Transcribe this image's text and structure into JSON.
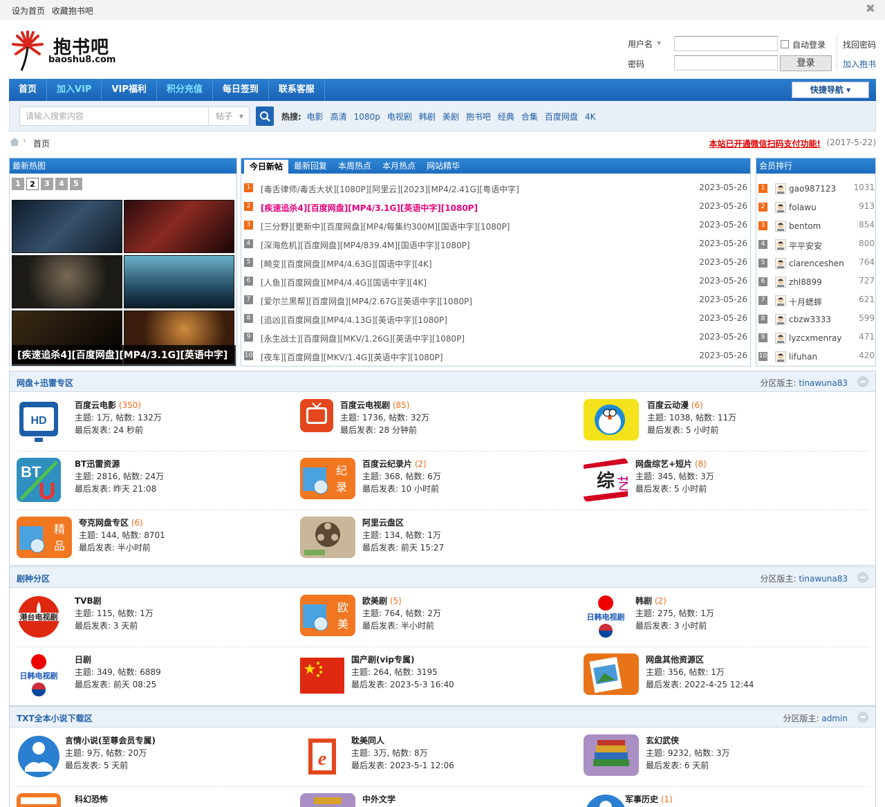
{
  "topbar": {
    "set_home": "设为首页",
    "bookmark": "收藏抱书吧"
  },
  "logo": {
    "cn": "抱书吧",
    "en": "baoshu8.com"
  },
  "login": {
    "username_label": "用户名",
    "password_label": "密码",
    "auto_login": "自动登录",
    "login_btn": "登录",
    "forgot": "找回密码",
    "register": "加入抱书"
  },
  "nav": {
    "items": [
      "首页",
      "加入VIP",
      "VIP福利",
      "积分充值",
      "每日签到",
      "联系客服"
    ],
    "quick_nav": "快捷导航"
  },
  "search": {
    "placeholder": "请输入搜索内容",
    "type": "帖子",
    "hot_label": "热搜:",
    "hot": [
      "电影",
      "高清",
      "1080p",
      "电视剧",
      "韩剧",
      "美剧",
      "抱书吧",
      "经典",
      "合集",
      "百度网盘",
      "4K"
    ]
  },
  "breadcrumb": {
    "home": "首页",
    "notice": "本站已开通微信扫码支付功能!",
    "date": "(2017-5-22)"
  },
  "hotpic": {
    "title": "最新热图",
    "nums": [
      "1",
      "2",
      "3",
      "4",
      "5"
    ],
    "caption": "[疾速追杀4][百度网盘][MP4/3.1G][英语中字]"
  },
  "newest": {
    "tabs": [
      "今日新帖",
      "最新回复",
      "本周热点",
      "本月热点",
      "网站精华"
    ],
    "rows": [
      {
        "n": "1",
        "title": "[毒舌律师/毒舌大状][1080P][阿里云][2023][MP4/2.41G][粤语中字]",
        "date": "2023-05-26"
      },
      {
        "n": "2",
        "title": "[疾速追杀4][百度网盘][MP4/3.1G][英语中字][1080P]",
        "date": "2023-05-26"
      },
      {
        "n": "3",
        "title": "[三分野][更新中][百度网盘][MP4/每集约300M][国语中字][1080P]",
        "date": "2023-05-26"
      },
      {
        "n": "4",
        "title": "[深海危机][百度网盘][MP4/839.4M][国语中字][1080P]",
        "date": "2023-05-26"
      },
      {
        "n": "5",
        "title": "[畸变][百度网盘][MP4/4.63G][国语中字][4K]",
        "date": "2023-05-26"
      },
      {
        "n": "6",
        "title": "[人鱼][百度网盘][MP4/4.4G][国语中字][4K]",
        "date": "2023-05-26"
      },
      {
        "n": "7",
        "title": "[爱尔兰黑帮][百度网盘][MP4/2.67G][英语中字][1080P]",
        "date": "2023-05-26"
      },
      {
        "n": "8",
        "title": "[追凶][百度网盘][MP4/4.13G][英语中字][1080P]",
        "date": "2023-05-26"
      },
      {
        "n": "9",
        "title": "[永生战士][百度网盘][MKV/1.26G][英语中字][1080P]",
        "date": "2023-05-26"
      },
      {
        "n": "10",
        "title": "[夜车][百度网盘][MKV/1.4G][英语中字][1080P]",
        "date": "2023-05-26"
      }
    ]
  },
  "ranking": {
    "title": "会员排行",
    "rows": [
      {
        "n": "1",
        "name": "gao987123",
        "score": "1031"
      },
      {
        "n": "2",
        "name": "folawu",
        "score": "913"
      },
      {
        "n": "3",
        "name": "bentom",
        "score": "854"
      },
      {
        "n": "4",
        "name": "平平安安",
        "score": "800"
      },
      {
        "n": "5",
        "name": "clarenceshen",
        "score": "764"
      },
      {
        "n": "6",
        "name": "zhl8899",
        "score": "727"
      },
      {
        "n": "7",
        "name": "十月蟋蟀",
        "score": "621"
      },
      {
        "n": "8",
        "name": "cbzw3333",
        "score": "599"
      },
      {
        "n": "9",
        "name": "lyzcxmenray",
        "score": "471"
      },
      {
        "n": "10",
        "name": "lifuhan",
        "score": "420"
      }
    ]
  },
  "sections": [
    {
      "title": "网盘+迅雷专区",
      "mod_label": "分区版主:",
      "mod": "tinawuna83",
      "forums": [
        {
          "name": "百度云电影",
          "count": "(350)",
          "stats": "主题: 1万, 帖数: 132万",
          "last": "最后发表: 24 秒前",
          "icon": "hd-tv-icon"
        },
        {
          "name": "百度云电视剧",
          "count": "(85)",
          "stats": "主题: 1736, 帖数: 32万",
          "last": "最后发表: 28 分钟前",
          "icon": "tv-icon"
        },
        {
          "name": "百度云动漫",
          "count": "(6)",
          "stats": "主题: 1038, 帖数: 11万",
          "last": "最后发表: 5 小时前",
          "icon": "doraemon-icon"
        },
        {
          "name": "BT迅雷资源",
          "count": "",
          "stats": "主题: 2816, 帖数: 24万",
          "last": "最后发表: 昨天 21:08",
          "icon": "bt-magnet-icon"
        },
        {
          "name": "百度云纪录片",
          "count": "(2)",
          "stats": "主题: 368, 帖数: 6万",
          "last": "最后发表: 10 小时前",
          "icon": "documentary-box-icon"
        },
        {
          "name": "网盘综艺+短片",
          "count": "(8)",
          "stats": "主题: 345, 帖数: 3万",
          "last": "最后发表: 5 小时前",
          "icon": "variety-show-icon"
        },
        {
          "name": "夸克网盘专区",
          "count": "(6)",
          "stats": "主题: 144, 帖数: 8701",
          "last": "最后发表: 半小时前",
          "icon": "premium-box-icon"
        },
        {
          "name": "阿里云盘区",
          "count": "",
          "stats": "主题: 134, 帖数: 1万",
          "last": "最后发表: 前天 15:27",
          "icon": "film-reel-icon"
        }
      ]
    },
    {
      "title": "剧种分区",
      "mod_label": "分区版主:",
      "mod": "tinawuna83",
      "forums": [
        {
          "name": "TVB剧",
          "count": "",
          "stats": "主题: 115, 帖数: 1万",
          "last": "最后发表: 3 天前",
          "icon": "hongkong-tv-icon"
        },
        {
          "name": "欧美剧",
          "count": "(5)",
          "stats": "主题: 764, 帖数: 2万",
          "last": "最后发表: 半小时前",
          "icon": "western-box-icon"
        },
        {
          "name": "韩剧",
          "count": "(2)",
          "stats": "主题: 275, 帖数: 1万",
          "last": "最后发表: 3 小时前",
          "icon": "korea-flag-icon"
        },
        {
          "name": "日剧",
          "count": "",
          "stats": "主题: 349, 帖数: 6889",
          "last": "最后发表: 前天 08:25",
          "icon": "japan-flag-icon"
        },
        {
          "name": "国产剧(vip专属)",
          "count": "",
          "stats": "主题: 264, 帖数: 3195",
          "last": "最后发表: 2023-5-3 16:40",
          "icon": "china-flag-icon"
        },
        {
          "name": "网盘其他资源区",
          "count": "",
          "stats": "主题: 356, 帖数: 1万",
          "last": "最后发表: 2022-4-25 12:44",
          "icon": "image-file-icon"
        }
      ]
    },
    {
      "title": "TXT全本小说下载区",
      "mod_label": "分区版主:",
      "mod": "admin",
      "forums": [
        {
          "name": "言情小说(至尊会员专属)",
          "count": "",
          "stats": "主题: 9万, 帖数: 20万",
          "last": "最后发表: 5 天前",
          "icon": "reader-icon"
        },
        {
          "name": "耽美同人",
          "count": "",
          "stats": "主题: 3万, 帖数: 8万",
          "last": "最后发表: 2023-5-1 12:06",
          "icon": "ebook-icon"
        },
        {
          "name": "玄幻武侠",
          "count": "",
          "stats": "主题: 9232, 帖数: 3万",
          "last": "最后发表: 6 天前",
          "icon": "books-stack-icon"
        },
        {
          "name": "科幻恐怖",
          "count": "",
          "stats": "",
          "last": "",
          "icon": "scifi-icon"
        },
        {
          "name": "中外文学",
          "count": "",
          "stats": "",
          "last": "",
          "icon": "literature-icon"
        },
        {
          "name": "军事历史",
          "count": "(1)",
          "stats": "",
          "last": "",
          "icon": "military-icon"
        }
      ]
    }
  ]
}
